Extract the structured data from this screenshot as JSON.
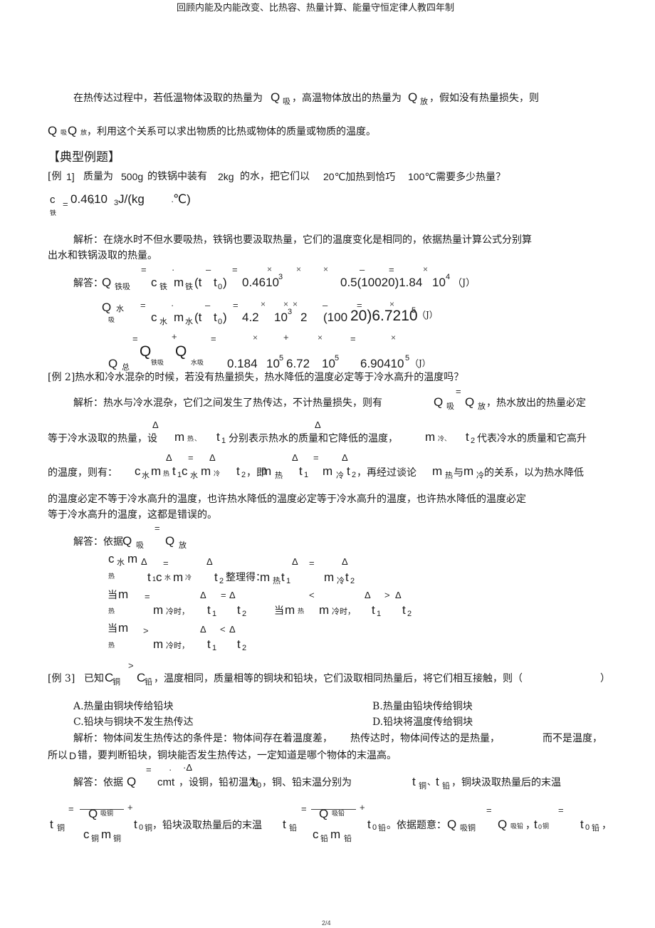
{
  "header": {
    "title": "回顾内能及内能改变、比热容、热量计算、能量守恒定律人教四年制"
  },
  "intro": {
    "line1": [
      "在热传达过程中，若低温物体汲取的热量为",
      "Q",
      "吸",
      "，高温物体放出的热量为",
      "Q",
      "放",
      "，假如没有热量损失，则"
    ],
    "line2": [
      "Q",
      "吸",
      "Q",
      "放",
      "，利用这个关系可以求出物质的比热或物体的质量或物质的温度。"
    ]
  },
  "section_heading": "【典型例题】",
  "example1": {
    "label": "[例",
    "num": "1]",
    "q": [
      "质量为",
      "500g",
      "的铁锅中装有",
      "2kg",
      "的水，把它们以",
      "20℃加热到恰巧",
      "100℃需要多少热量？"
    ],
    "given": [
      "c",
      "铁",
      "=",
      "0.4610",
      "3",
      "J/(kg",
      "·",
      "℃)",
      "×"
    ],
    "analysis": [
      "解析：在烧水时不但水要吸热，铁锅也要汲取热量，它们的温度变化是相同的，依据热量计算公式分别算",
      "出水和铁锅汲取的热量。"
    ],
    "answer_label": "解答：",
    "row1": {
      "Q": "Q",
      "sub": "铁吸",
      "ops": [
        "=",
        "·",
        "–",
        "=",
        "×",
        "×",
        "×",
        "–",
        "=",
        "×"
      ],
      "terms": [
        "c",
        "铁",
        "m",
        "铁",
        "(t",
        "t",
        "0",
        ")",
        "0.4610",
        "3",
        "0.5(10020)1.84",
        "10",
        "4",
        "（J）"
      ]
    },
    "row2": {
      "Q": "Q",
      "sub1": "水",
      "sub2": "吸",
      "ops": [
        "=",
        "·",
        "–",
        "=",
        "×",
        "×",
        "×",
        "–",
        "=",
        "×"
      ],
      "terms": [
        "c",
        "水",
        "m",
        "水",
        "(t",
        "t",
        "0",
        ")",
        "4.2",
        "10",
        "3",
        "2",
        "(100",
        "20)6.7210",
        "5",
        "（J）"
      ]
    },
    "row3": {
      "Q": "Q",
      "sub": "总",
      "ops": [
        "=",
        "+",
        "=",
        "×",
        "+",
        "×",
        "=",
        "×"
      ],
      "terms": [
        "Q",
        "铁吸",
        "Q",
        "水吸",
        "0.184",
        "10",
        "5",
        "6.72",
        "10",
        "5",
        "6.90410",
        "5",
        "（J）"
      ]
    }
  },
  "example2": {
    "question": "[例 2]热水和冷水混杂的时候，若没有热量损失，热水降低的温度必定等于冷水高升的温度吗？",
    "analysis_l1": [
      "解析：热水与冷水混杂，它们之间发生了热传达，不计热量损失，则有",
      "Q",
      "吸",
      "=",
      "Q",
      "放",
      "，热水放出的热量必定"
    ],
    "analysis_l2": [
      "等于冷水汲取的热量，设",
      "m",
      "热",
      "、",
      "Δ",
      "t",
      "1",
      "分别表示热水的质量和它降低的温度，",
      "m",
      "冷",
      "、",
      "Δ",
      "t",
      "2",
      "代表冷水的质量和它高升"
    ],
    "analysis_l3": [
      "的温度，则有：",
      "c",
      "水",
      "m",
      "热",
      "Δ",
      "t",
      "1",
      "c",
      "水",
      "m",
      "冷",
      "=",
      "Δ",
      "t",
      "2",
      "，即",
      "m",
      "热",
      "Δ",
      "t",
      "1",
      "=",
      "m",
      "冷",
      "Δ",
      "t",
      "2",
      "，再经过谈论",
      "m",
      "热",
      "与",
      "m",
      "冷",
      "的关系，以为热水降低"
    ],
    "analysis_l4": "的温度必定不等于冷水高升的温度，也许热水降低的温度必定等于冷水高升的温度，也许热水降低的温度必定",
    "analysis_l5": "等于冷水高升的温度，这都是错误的。",
    "answer_l1": [
      "解答：依据",
      "Q",
      "吸",
      "=",
      "Q",
      "放"
    ],
    "answer_l2": [
      "c",
      "水",
      "m",
      "热",
      "Δ",
      "=",
      "t",
      "1",
      "c",
      "水",
      "m",
      "冷",
      "Δ",
      "t",
      "2",
      "整理得：",
      "m",
      "热",
      "t",
      "1",
      "Δ",
      "=",
      "Δ",
      "m",
      "冷",
      "t",
      "2"
    ],
    "case1": [
      "当",
      "m",
      "热",
      "=",
      "m",
      "冷时，",
      "Δ",
      "t",
      "1",
      "=",
      "Δ",
      "t",
      "2"
    ],
    "case2": [
      "当",
      "m",
      "热",
      "<",
      "m",
      "冷时，",
      "Δ",
      "t",
      "1",
      ">",
      "Δ",
      "t",
      "2"
    ],
    "case3": [
      "当",
      "m",
      "热",
      ">",
      "m",
      "冷时，",
      "Δ",
      "t",
      "1",
      "<",
      "Δ",
      "t",
      "2"
    ]
  },
  "example3": {
    "question": [
      "[例 3]",
      "已知",
      "C",
      "铜",
      ">",
      "C",
      "铅",
      "，温度相同，质量相等的铜块和铅块，它们汲取相同热量后，将它们相互接触，则（",
      "）"
    ],
    "options": [
      {
        "label": "A.热量由铜块传给铅块"
      },
      {
        "label": "B.热量由铅块传给铜块"
      },
      {
        "label": "C.铅块与铜块不发生热传达"
      },
      {
        "label": "D.铅块将温度传给铜块"
      }
    ],
    "analysis_l1": [
      "解析：物体间发生热传达的条件是：物体间存在着温度差，",
      "热传达时，物体间传达的是热量，",
      "而不是温度，"
    ],
    "analysis_l2": [
      "所以",
      "D",
      "错，要判断铅块，铜块能否发生热传达，一定知道是哪个物体的末温高。"
    ],
    "answer_l1": [
      "解答：依据",
      "Q",
      "=",
      "·",
      "·Δ",
      "cmt",
      "，设铜，铅初温为",
      "t",
      "0",
      "，铜、铅末温分别为",
      "t",
      "铜",
      "、",
      "t",
      "铅",
      "，铜块汲取热量后的末温"
    ],
    "answer_l2": {
      "t_cu": [
        "t",
        "铜"
      ],
      "frac_cu_num": [
        "Q",
        "吸铜"
      ],
      "frac_cu_den": [
        "c",
        "铜",
        "m",
        "铜"
      ],
      "t0_cu": [
        "t",
        "0",
        "铜"
      ],
      "mid_text": "，铅块汲取热量后的末温",
      "t_pb": [
        "t",
        "铅"
      ],
      "frac_pb_num": [
        "Q",
        "吸铅"
      ],
      "frac_pb_den": [
        "c",
        "铅",
        "m",
        "铅"
      ],
      "t0_pb": [
        "t",
        "0",
        "铅"
      ],
      "tail": [
        "。依据题意：",
        "Q",
        "吸铜",
        "Q",
        "吸铅",
        "，",
        "t",
        "0",
        "铜",
        "t",
        "0",
        "铅",
        "，"
      ],
      "ops": [
        "=",
        "+",
        "=",
        "+",
        "=",
        "="
      ]
    }
  },
  "footer": {
    "page": "2/4"
  }
}
